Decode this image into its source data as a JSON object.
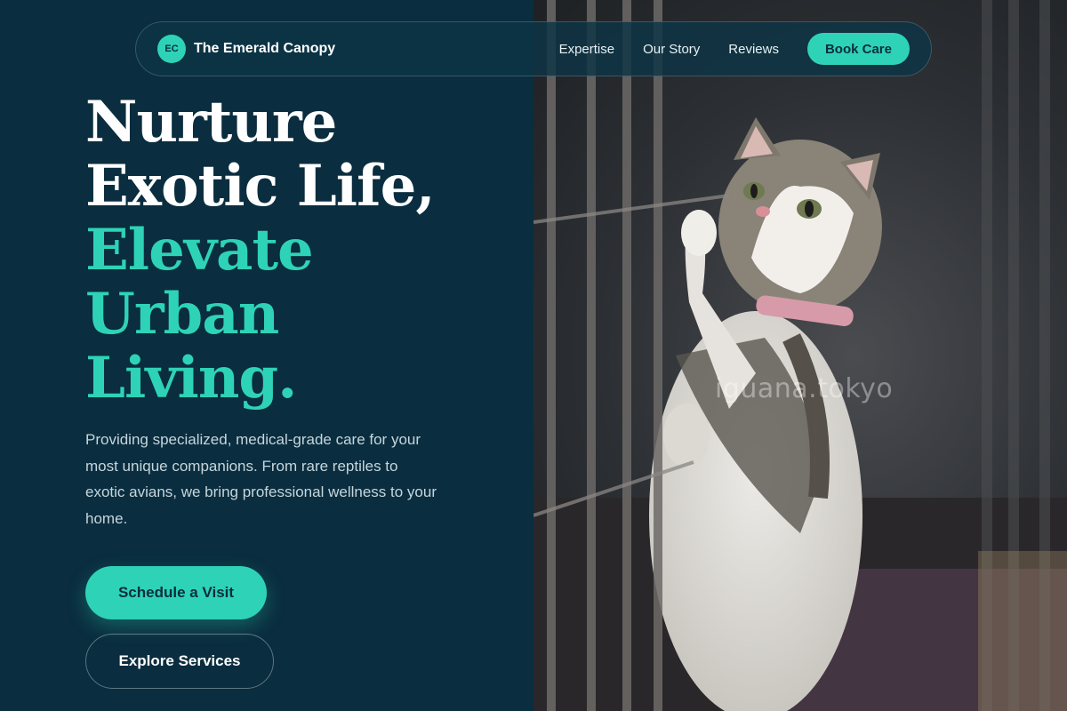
{
  "nav": {
    "logo_initials": "EC",
    "brand": "The Emerald Canopy",
    "links": [
      "Expertise",
      "Our Story",
      "Reviews"
    ],
    "cta": "Book Care"
  },
  "hero": {
    "headline_white": [
      "Nurture",
      "Exotic Life,"
    ],
    "headline_teal": [
      "Elevate",
      "Urban",
      "Living."
    ],
    "lead": "Providing specialized, medical-grade care for your most unique companions. From rare reptiles to exotic avians, we bring professional wellness to your home.",
    "primary_button": "Schedule a Visit",
    "secondary_button": "Explore Services"
  },
  "image": {
    "watermark": "iguana.tokyo",
    "alt": "kitten reaching through cage bars"
  },
  "colors": {
    "background": "#0a2d3f",
    "accent": "#2ed3b7",
    "text_light": "#c5d6dc"
  }
}
